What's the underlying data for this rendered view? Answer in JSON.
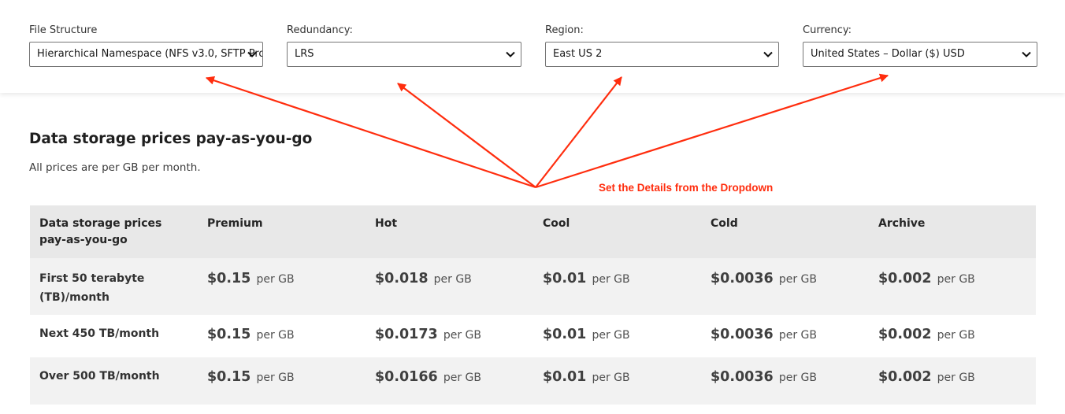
{
  "filters": {
    "file_structure": {
      "label": "File Structure",
      "value": "Hierarchical Namespace (NFS v3.0, SFTP Pro"
    },
    "redundancy": {
      "label": "Redundancy:",
      "value": "LRS"
    },
    "region": {
      "label": "Region:",
      "value": "East US 2"
    },
    "currency": {
      "label": "Currency:",
      "value": "United States – Dollar ($) USD"
    }
  },
  "section": {
    "title": "Data storage prices pay-as-you-go",
    "subtitle": "All prices are per GB per month."
  },
  "callout": {
    "text": "Set the Details from the Dropdown",
    "color": "#ff2d0e"
  },
  "table": {
    "headers": [
      "Data storage prices pay-as-you-go",
      "Premium",
      "Hot",
      "Cool",
      "Cold",
      "Archive"
    ],
    "unit": "per GB",
    "rows": [
      {
        "tier": "First 50 terabyte (TB)/month",
        "prices": [
          "$0.15",
          "$0.018",
          "$0.01",
          "$0.0036",
          "$0.002"
        ]
      },
      {
        "tier": "Next 450 TB/month",
        "prices": [
          "$0.15",
          "$0.0173",
          "$0.01",
          "$0.0036",
          "$0.002"
        ]
      },
      {
        "tier": "Over 500 TB/month",
        "prices": [
          "$0.15",
          "$0.0166",
          "$0.01",
          "$0.0036",
          "$0.002"
        ]
      }
    ]
  },
  "icons": {
    "dropdown": "chevron-down-icon"
  }
}
